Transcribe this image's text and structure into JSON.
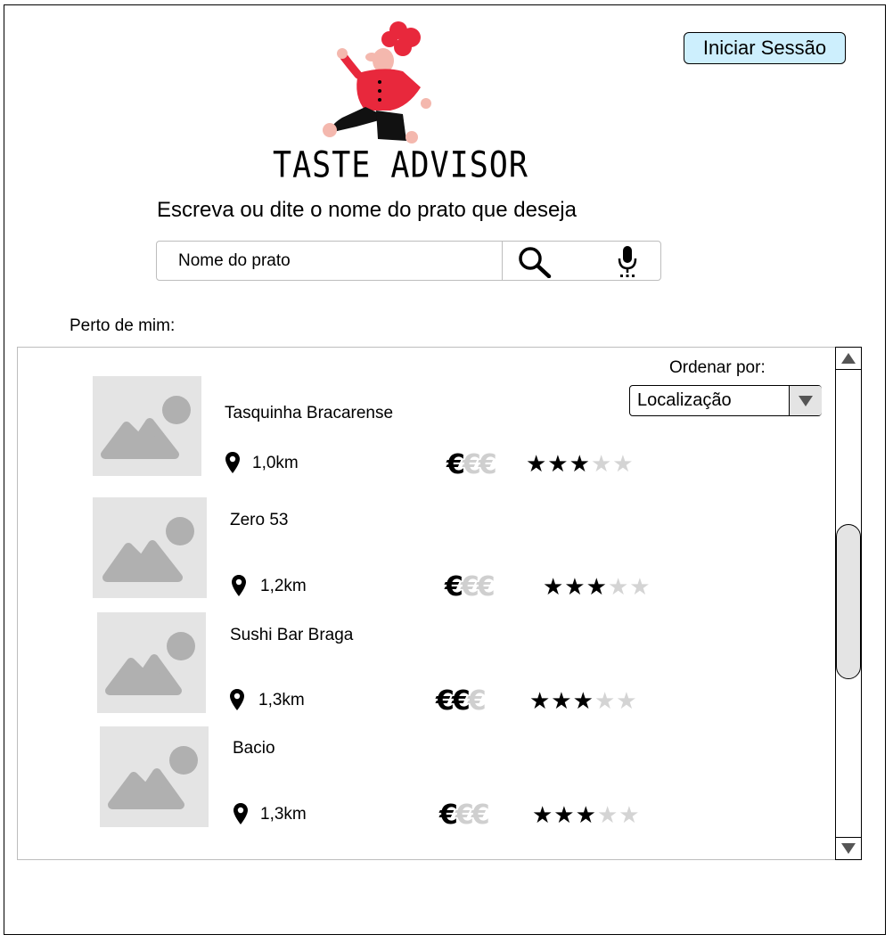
{
  "header": {
    "brand": "TASTE ADVISOR",
    "login_label": "Iniciar Sessão",
    "prompt": "Escreva ou dite o nome do prato que deseja"
  },
  "search": {
    "placeholder": "Nome do prato",
    "search_icon": "search-icon",
    "mic_icon": "microphone-icon"
  },
  "nearby": {
    "label": "Perto de mim:",
    "sort_label": "Ordenar por:",
    "sort_value": "Localização"
  },
  "restaurants": [
    {
      "name": "Tasquinha Bracarense",
      "distance": "1,0km",
      "price_level": 1,
      "price_max": 3,
      "rating": 3,
      "rating_max": 5
    },
    {
      "name": "Zero 53",
      "distance": "1,2km",
      "price_level": 1,
      "price_max": 3,
      "rating": 3,
      "rating_max": 5
    },
    {
      "name": "Sushi Bar Braga",
      "distance": "1,3km",
      "price_level": 2,
      "price_max": 3,
      "rating": 3,
      "rating_max": 5
    },
    {
      "name": "Bacio",
      "distance": "1,3km",
      "price_level": 1,
      "price_max": 3,
      "rating": 3,
      "rating_max": 5
    }
  ],
  "colors": {
    "login_button_bg": "#cdeffd",
    "placeholder_gray": "#e4e4e4",
    "inactive_gray": "#cfcfcf",
    "chef_red": "#e8283c"
  }
}
